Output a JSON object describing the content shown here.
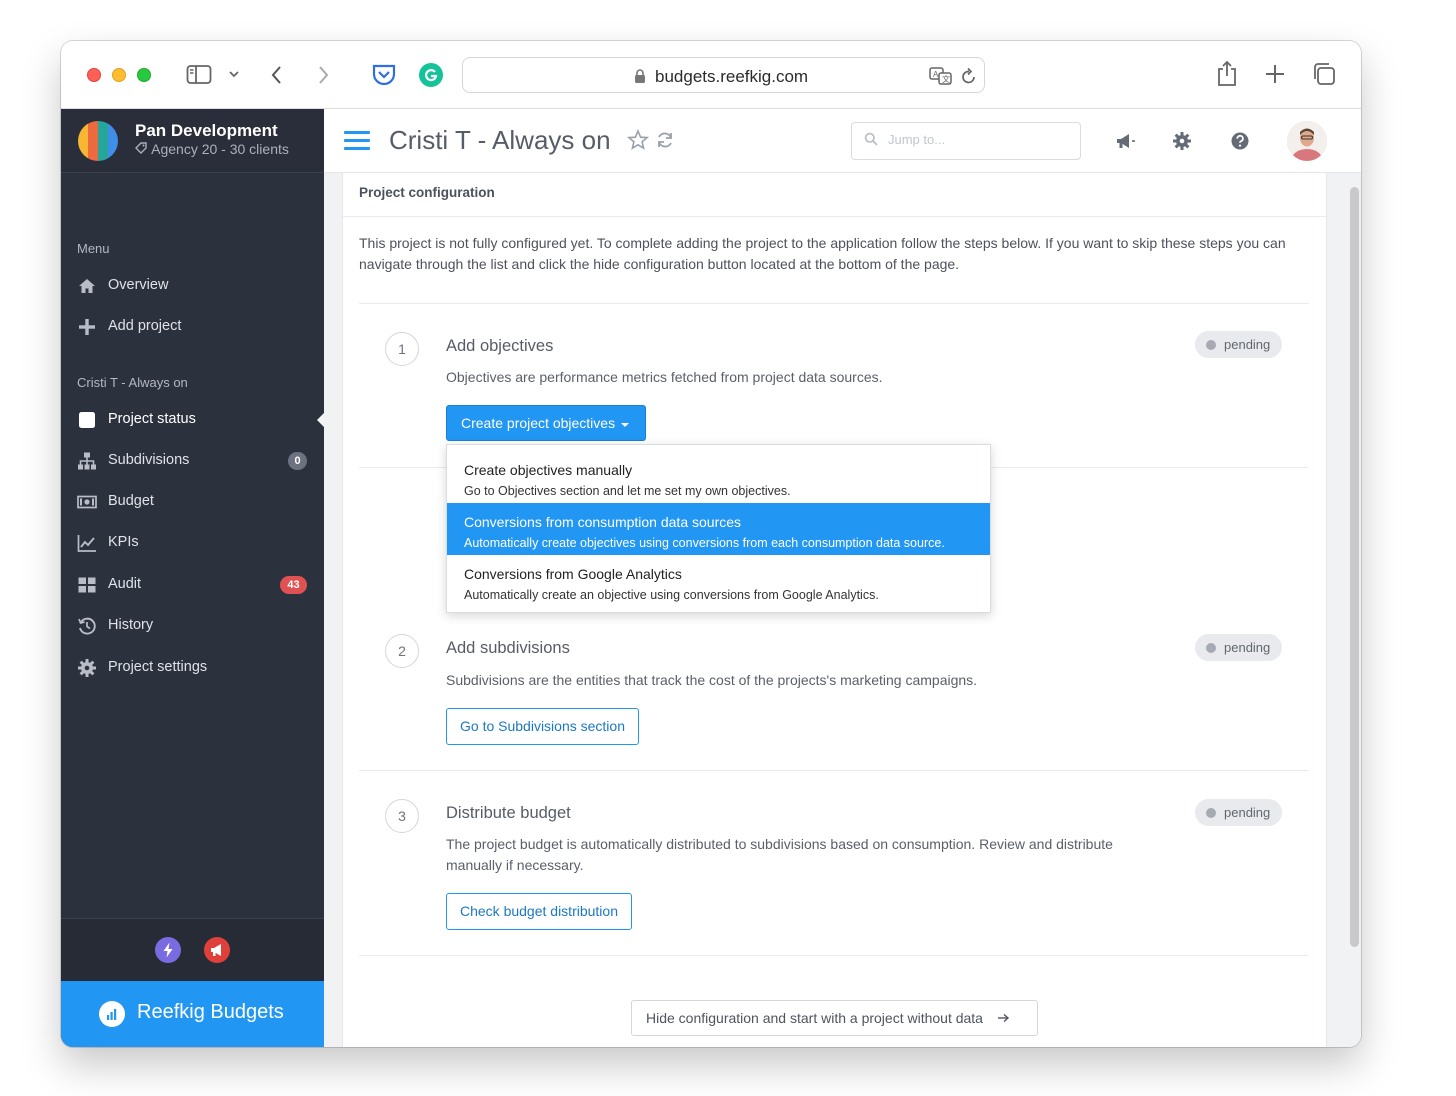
{
  "browser": {
    "url": "budgets.reefkig.com",
    "icons": [
      "sidebar-toggle-icon",
      "chevron-down-icon",
      "back-icon",
      "forward-icon",
      "pocket-icon",
      "grammarly-icon",
      "lock-icon",
      "translate-icon",
      "reload-icon",
      "share-icon",
      "new-tab-icon",
      "tabs-overview-icon"
    ]
  },
  "brand": {
    "title": "Pan Development",
    "subtitle": "Agency 20 - 30 clients"
  },
  "sidebar": {
    "menu_label": "Menu",
    "menu_items": [
      {
        "label": "Overview",
        "icon": "home-icon"
      },
      {
        "label": "Add project",
        "icon": "plus-icon"
      }
    ],
    "project_label": "Cristi T - Always on",
    "project_items": [
      {
        "label": "Project status",
        "icon": "square-icon",
        "active": true
      },
      {
        "label": "Subdivisions",
        "icon": "sitemap-icon",
        "badge": "0"
      },
      {
        "label": "Budget",
        "icon": "money-icon"
      },
      {
        "label": "KPIs",
        "icon": "line-chart-icon"
      },
      {
        "label": "Audit",
        "icon": "grid-icon",
        "badge": "43"
      },
      {
        "label": "History",
        "icon": "history-icon"
      },
      {
        "label": "Project settings",
        "icon": "gear-icon"
      }
    ],
    "footer_brand": "Reefkig Budgets"
  },
  "topbar": {
    "title": "Cristi T - Always on",
    "search_placeholder": "Jump to..."
  },
  "config": {
    "heading": "Project configuration",
    "intro": "This project is not fully configured yet. To complete adding the project to the application follow the steps below. If you want to skip these steps you can navigate through the list and click the hide configuration button located at the bottom of the page.",
    "steps": [
      {
        "number": "1",
        "title": "Add objectives",
        "description": "Objectives are performance metrics fetched from project data sources.",
        "status": "pending",
        "button": "Create project objectives"
      },
      {
        "number": "2",
        "title": "Add subdivisions",
        "description": "Subdivisions are the entities that track the cost of the projects's marketing campaigns.",
        "status": "pending",
        "button": "Go to Subdivisions section"
      },
      {
        "number": "3",
        "title": "Distribute budget",
        "description": "The project budget is automatically distributed to subdivisions based on consumption. Review and distribute manually if necessary.",
        "status": "pending",
        "button": "Check budget distribution"
      }
    ],
    "dropdown": [
      {
        "title": "Create objectives manually",
        "subtitle": "Go to Objectives section and let me set my own objectives.",
        "highlighted": false
      },
      {
        "title": "Conversions from consumption data sources",
        "subtitle": "Automatically create objectives using conversions from each consumption data source.",
        "highlighted": true
      },
      {
        "title": "Conversions from Google Analytics",
        "subtitle": "Automatically create an objective using conversions from Google Analytics.",
        "highlighted": false
      }
    ],
    "hide_button": "Hide configuration and start with a project without data"
  },
  "colors": {
    "accent": "#2196f3",
    "sidebar_bg": "#2c313e",
    "badge_danger": "#e05252",
    "badge_neutral": "#6c7280"
  }
}
